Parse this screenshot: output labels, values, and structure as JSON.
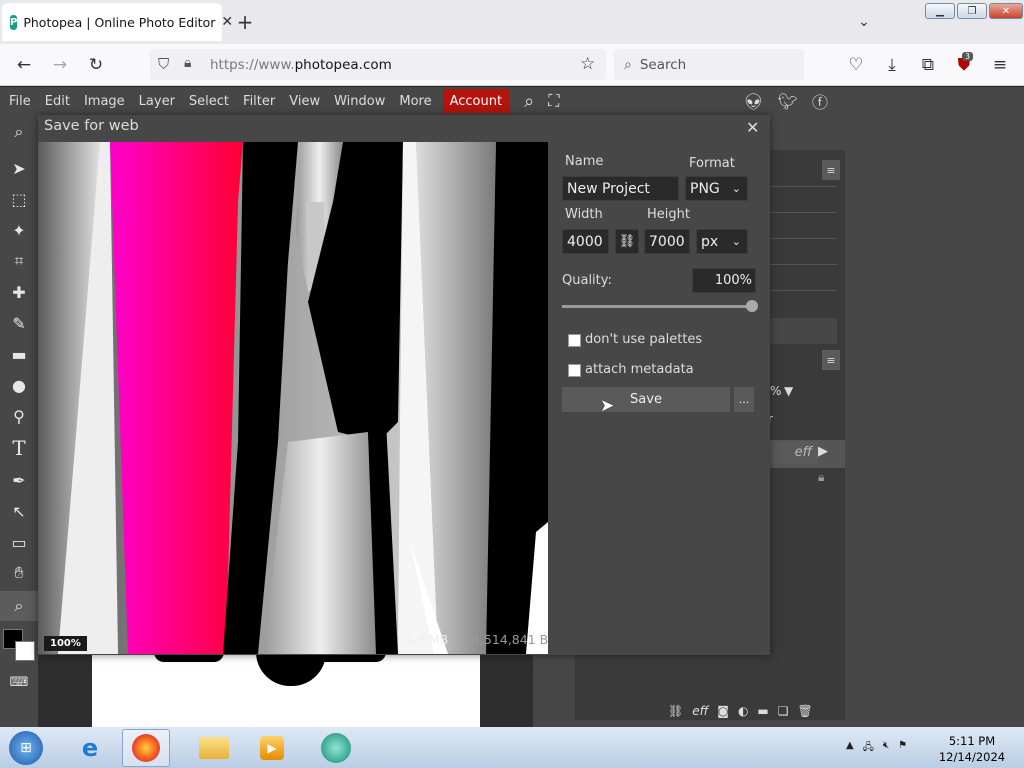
{
  "browser": {
    "tab_title": "Photopea | Online Photo Editor",
    "tab_close": "✕",
    "new_tab": "+",
    "url_prefix": "https://www.",
    "url_domain": "photopea.com",
    "search_placeholder": "Search",
    "extension_badge": "3"
  },
  "menu": {
    "items": [
      "File",
      "Edit",
      "Image",
      "Layer",
      "Select",
      "Filter",
      "View",
      "Window",
      "More"
    ],
    "account": "Account"
  },
  "dialog": {
    "title": "Save for web",
    "close": "✕",
    "name_label": "Name",
    "name_value": "New Project",
    "format_label": "Format",
    "format_value": "PNG",
    "width_label": "Width",
    "width_value": "4000",
    "height_label": "Height",
    "height_value": "7000",
    "unit_value": "px",
    "quality_label": "Quality:",
    "quality_value": "100%",
    "quality_fraction": 1.0,
    "dont_use_palettes": "don't use palettes",
    "attach_metadata": "attach metadata",
    "save": "Save",
    "more": "...",
    "zoom": "100%",
    "file_size": "4.3 MB",
    "file_bytes": "4,514,841 B"
  },
  "panel": {
    "percent_fragment": "%",
    "letter_fragment": "r",
    "eff_label": "eff",
    "bottom_eff": "eff"
  },
  "taskbar": {
    "time": "5:11 PM",
    "date": "12/14/2024"
  },
  "colors": {
    "accent_account": "#b4140d",
    "app_bg": "#474747",
    "preview_magenta": "#ff00c8",
    "preview_red": "#ff0033"
  }
}
